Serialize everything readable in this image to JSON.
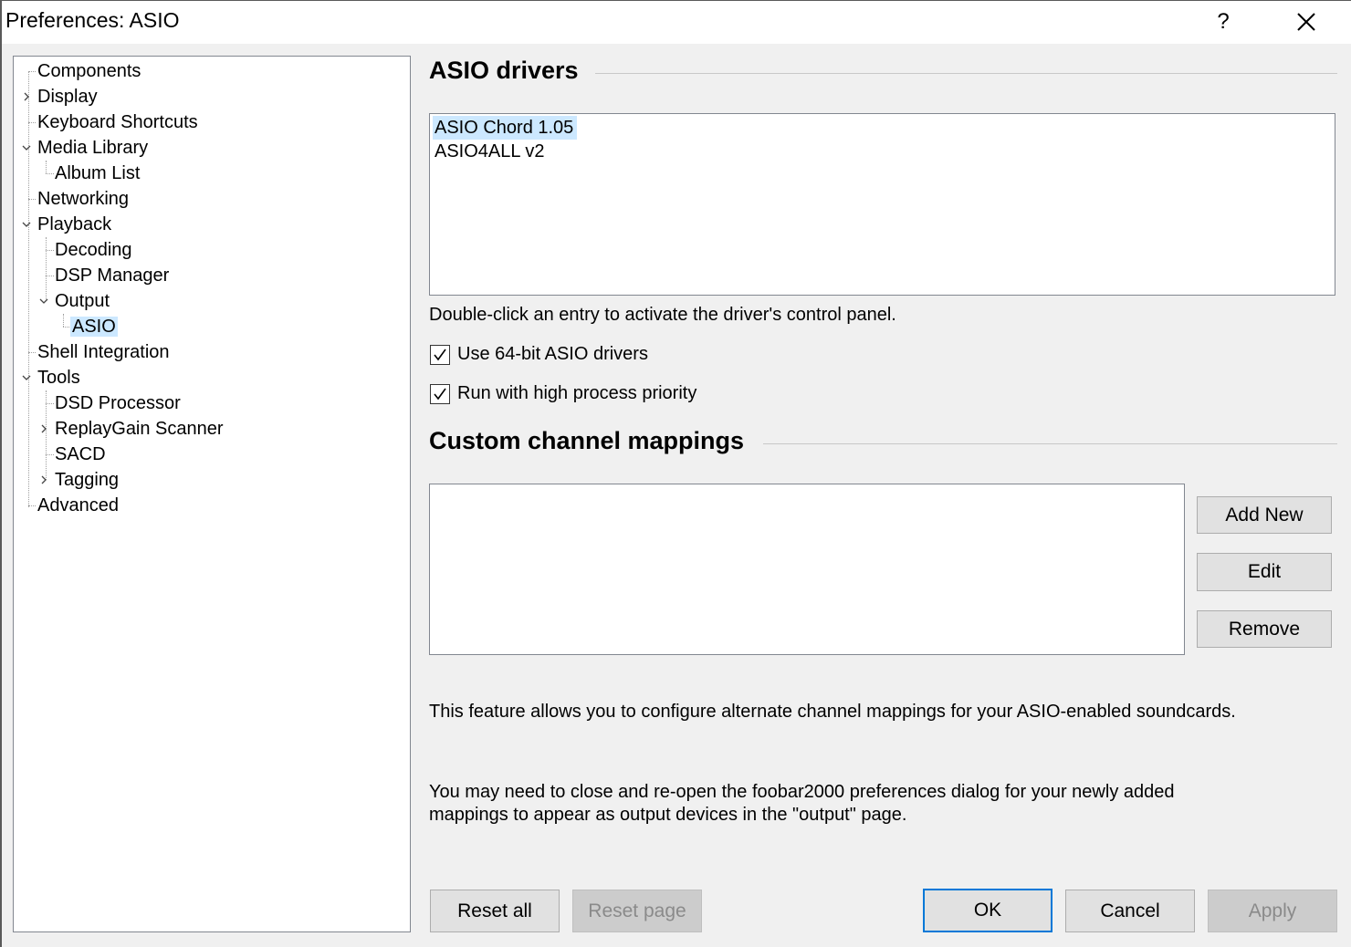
{
  "window": {
    "title": "Preferences: ASIO",
    "help_glyph": "?",
    "close_icon": "close-icon"
  },
  "tree": {
    "items": [
      {
        "label": "Components",
        "expander": "none"
      },
      {
        "label": "Display",
        "expander": "collapsed"
      },
      {
        "label": "Keyboard Shortcuts",
        "expander": "none"
      },
      {
        "label": "Media Library",
        "expander": "expanded"
      },
      {
        "label": "Album List",
        "expander": "none"
      },
      {
        "label": "Networking",
        "expander": "none"
      },
      {
        "label": "Playback",
        "expander": "expanded"
      },
      {
        "label": "Decoding",
        "expander": "none"
      },
      {
        "label": "DSP Manager",
        "expander": "none"
      },
      {
        "label": "Output",
        "expander": "expanded"
      },
      {
        "label": "ASIO",
        "expander": "none",
        "selected": true
      },
      {
        "label": "Shell Integration",
        "expander": "none"
      },
      {
        "label": "Tools",
        "expander": "expanded"
      },
      {
        "label": "DSD Processor",
        "expander": "none"
      },
      {
        "label": "ReplayGain Scanner",
        "expander": "collapsed"
      },
      {
        "label": "SACD",
        "expander": "none"
      },
      {
        "label": "Tagging",
        "expander": "collapsed"
      },
      {
        "label": "Advanced",
        "expander": "none"
      }
    ]
  },
  "asio_drivers": {
    "heading": "ASIO drivers",
    "drivers": [
      {
        "name": "ASIO Chord  1.05",
        "selected": true
      },
      {
        "name": "ASIO4ALL v2",
        "selected": false
      }
    ],
    "hint": "Double-click an entry to activate the driver's control panel.",
    "use_64bit": {
      "label": "Use 64-bit ASIO drivers",
      "checked": true
    },
    "high_priority": {
      "label": "Run with high process priority",
      "checked": true
    }
  },
  "mappings": {
    "heading": "Custom channel mappings",
    "add_label": "Add New",
    "edit_label": "Edit",
    "remove_label": "Remove",
    "info1": "This feature allows you to configure alternate channel mappings for your ASIO-enabled soundcards.",
    "info2": "You may need to close and re-open the foobar2000 preferences dialog for your newly added mappings to appear as output devices in the \"output\" page."
  },
  "footer": {
    "reset_all": "Reset all",
    "reset_page": "Reset page",
    "ok": "OK",
    "cancel": "Cancel",
    "apply": "Apply"
  },
  "colors": {
    "selection": "#cce8ff",
    "accent": "#0078d7"
  }
}
